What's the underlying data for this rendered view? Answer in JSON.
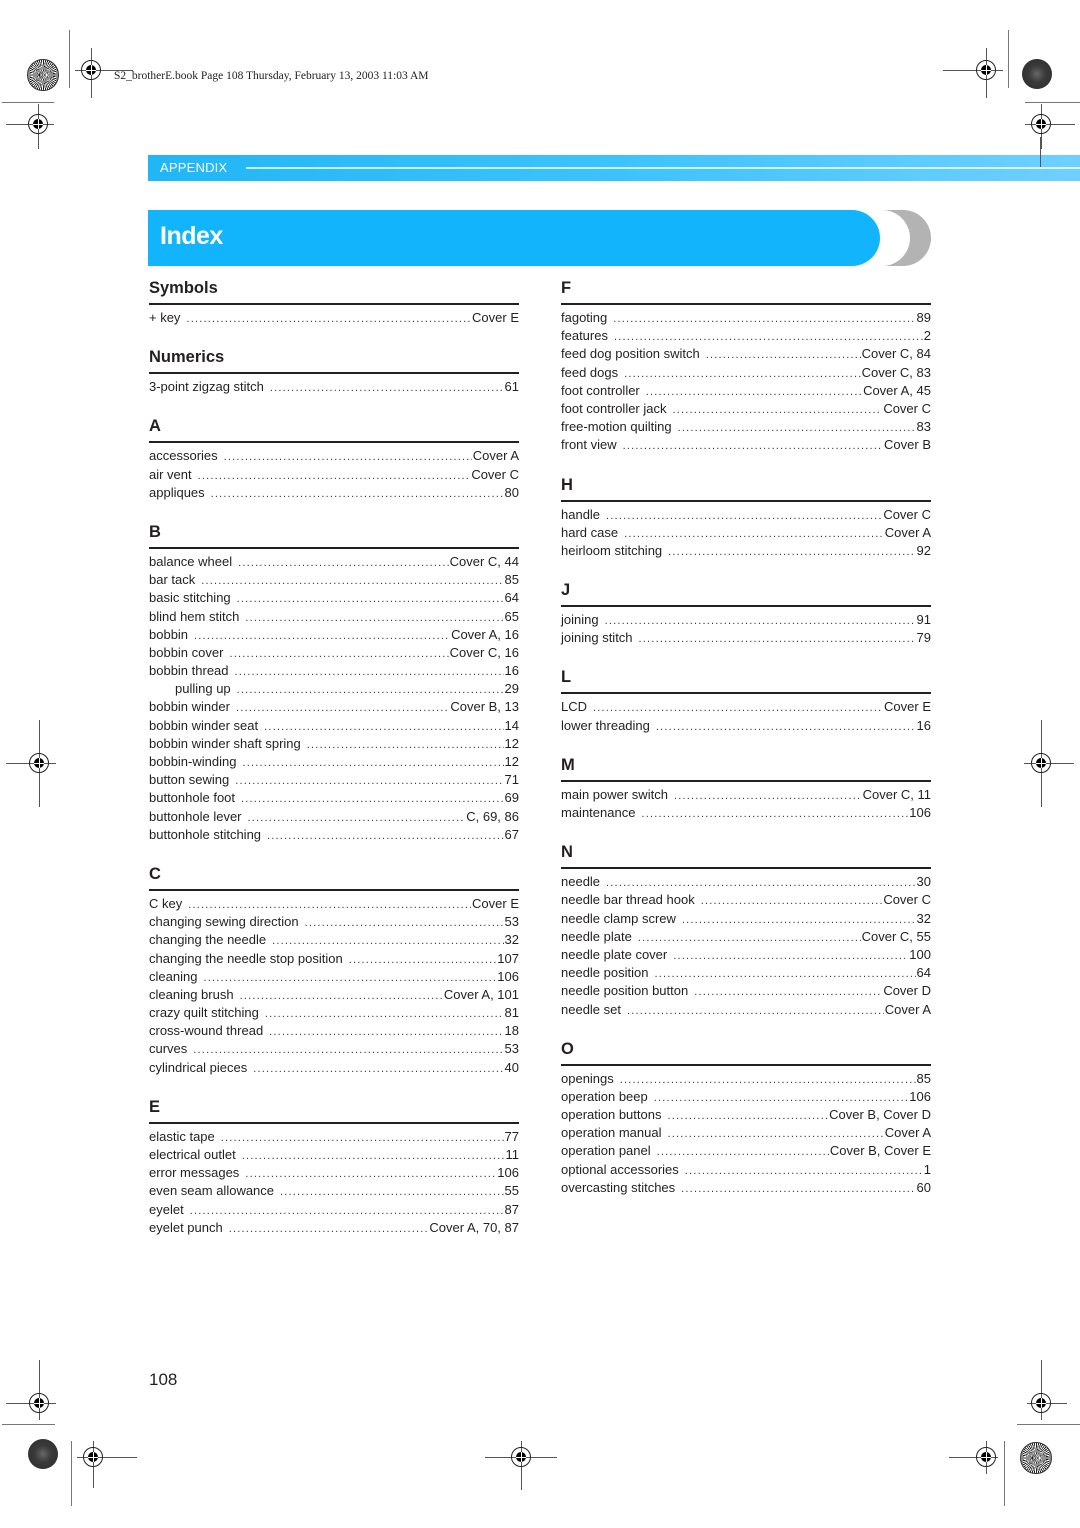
{
  "slug_line": "S2_brotherE.book  Page 108  Thursday, February 13, 2003  11:03 AM",
  "appendix_label": "APPENDIX",
  "title": "Index",
  "colors": {
    "accent": "#12b5fb",
    "appendix_bar": "#3cc3fb",
    "tab_grey": "#b3b3b3",
    "text": "#231f20"
  },
  "page_number": "108",
  "left_column": [
    {
      "heading": "Symbols",
      "entries": [
        {
          "term": "+ key",
          "page": "Cover E"
        }
      ]
    },
    {
      "heading": "Numerics",
      "entries": [
        {
          "term": "3-point zigzag stitch",
          "page": "61"
        }
      ]
    },
    {
      "heading": "A",
      "entries": [
        {
          "term": "accessories",
          "page": "Cover A"
        },
        {
          "term": "air vent",
          "page": "Cover C"
        },
        {
          "term": "appliques",
          "page": "80"
        }
      ]
    },
    {
      "heading": "B",
      "entries": [
        {
          "term": "balance wheel",
          "page": "Cover C, 44"
        },
        {
          "term": "bar tack",
          "page": "85"
        },
        {
          "term": "basic stitching",
          "page": "64"
        },
        {
          "term": "blind hem stitch",
          "page": "65"
        },
        {
          "term": "bobbin",
          "page": "Cover A, 16"
        },
        {
          "term": "bobbin cover",
          "page": "Cover C, 16"
        },
        {
          "term": "bobbin thread",
          "page": "16"
        },
        {
          "term": "pulling up",
          "page": "29",
          "sub": true
        },
        {
          "term": "bobbin winder",
          "page": "Cover B, 13"
        },
        {
          "term": "bobbin winder seat",
          "page": "14"
        },
        {
          "term": "bobbin winder shaft spring",
          "page": "12"
        },
        {
          "term": "bobbin-winding",
          "page": "12"
        },
        {
          "term": "button sewing",
          "page": "71"
        },
        {
          "term": "buttonhole foot",
          "page": "69"
        },
        {
          "term": "buttonhole lever",
          "page": "C, 69, 86"
        },
        {
          "term": "buttonhole stitching",
          "page": "67"
        }
      ]
    },
    {
      "heading": "C",
      "entries": [
        {
          "term": "C key",
          "page": "Cover E"
        },
        {
          "term": "changing sewing direction",
          "page": "53"
        },
        {
          "term": "changing the needle",
          "page": "32"
        },
        {
          "term": "changing the needle stop position",
          "page": "107"
        },
        {
          "term": "cleaning",
          "page": "106"
        },
        {
          "term": "cleaning brush",
          "page": "Cover A, 101"
        },
        {
          "term": "crazy quilt stitching",
          "page": "81"
        },
        {
          "term": "cross-wound thread",
          "page": "18"
        },
        {
          "term": "curves",
          "page": "53"
        },
        {
          "term": "cylindrical pieces",
          "page": "40"
        }
      ]
    },
    {
      "heading": "E",
      "entries": [
        {
          "term": "elastic tape",
          "page": "77"
        },
        {
          "term": "electrical outlet",
          "page": "11"
        },
        {
          "term": "error messages",
          "page": "106"
        },
        {
          "term": "even seam allowance",
          "page": "55"
        },
        {
          "term": "eyelet",
          "page": "87"
        },
        {
          "term": "eyelet punch",
          "page": "Cover A, 70, 87"
        }
      ]
    }
  ],
  "right_column": [
    {
      "heading": "F",
      "entries": [
        {
          "term": "fagoting",
          "page": "89"
        },
        {
          "term": "features",
          "page": "2"
        },
        {
          "term": "feed dog position switch",
          "page": "Cover C, 84"
        },
        {
          "term": "feed dogs",
          "page": "Cover C, 83"
        },
        {
          "term": "foot controller",
          "page": "Cover A, 45"
        },
        {
          "term": "foot controller jack",
          "page": "Cover C"
        },
        {
          "term": "free-motion quilting",
          "page": "83"
        },
        {
          "term": "front view",
          "page": "Cover B"
        }
      ]
    },
    {
      "heading": "H",
      "entries": [
        {
          "term": "handle",
          "page": "Cover C"
        },
        {
          "term": "hard case",
          "page": "Cover A"
        },
        {
          "term": "heirloom stitching",
          "page": "92"
        }
      ]
    },
    {
      "heading": "J",
      "entries": [
        {
          "term": "joining",
          "page": "91"
        },
        {
          "term": "joining stitch",
          "page": "79"
        }
      ]
    },
    {
      "heading": "L",
      "entries": [
        {
          "term": "LCD",
          "page": "Cover E"
        },
        {
          "term": "lower threading",
          "page": "16"
        }
      ]
    },
    {
      "heading": "M",
      "entries": [
        {
          "term": "main power switch",
          "page": "Cover C, 11"
        },
        {
          "term": "maintenance",
          "page": "106"
        }
      ]
    },
    {
      "heading": "N",
      "entries": [
        {
          "term": "needle",
          "page": "30"
        },
        {
          "term": "needle bar thread hook",
          "page": "Cover C"
        },
        {
          "term": "needle clamp screw",
          "page": "32"
        },
        {
          "term": "needle plate",
          "page": "Cover C, 55"
        },
        {
          "term": "needle plate cover",
          "page": "100"
        },
        {
          "term": "needle position",
          "page": "64"
        },
        {
          "term": "needle position button",
          "page": "Cover D"
        },
        {
          "term": "needle set",
          "page": "Cover A"
        }
      ]
    },
    {
      "heading": "O",
      "entries": [
        {
          "term": "openings",
          "page": "85"
        },
        {
          "term": "operation beep",
          "page": "106"
        },
        {
          "term": "operation buttons",
          "page": "Cover B, Cover D"
        },
        {
          "term": "operation manual",
          "page": "Cover A"
        },
        {
          "term": "operation panel",
          "page": "Cover B, Cover E"
        },
        {
          "term": "optional accessories",
          "page": "1"
        },
        {
          "term": "overcasting stitches",
          "page": "60"
        }
      ]
    }
  ]
}
